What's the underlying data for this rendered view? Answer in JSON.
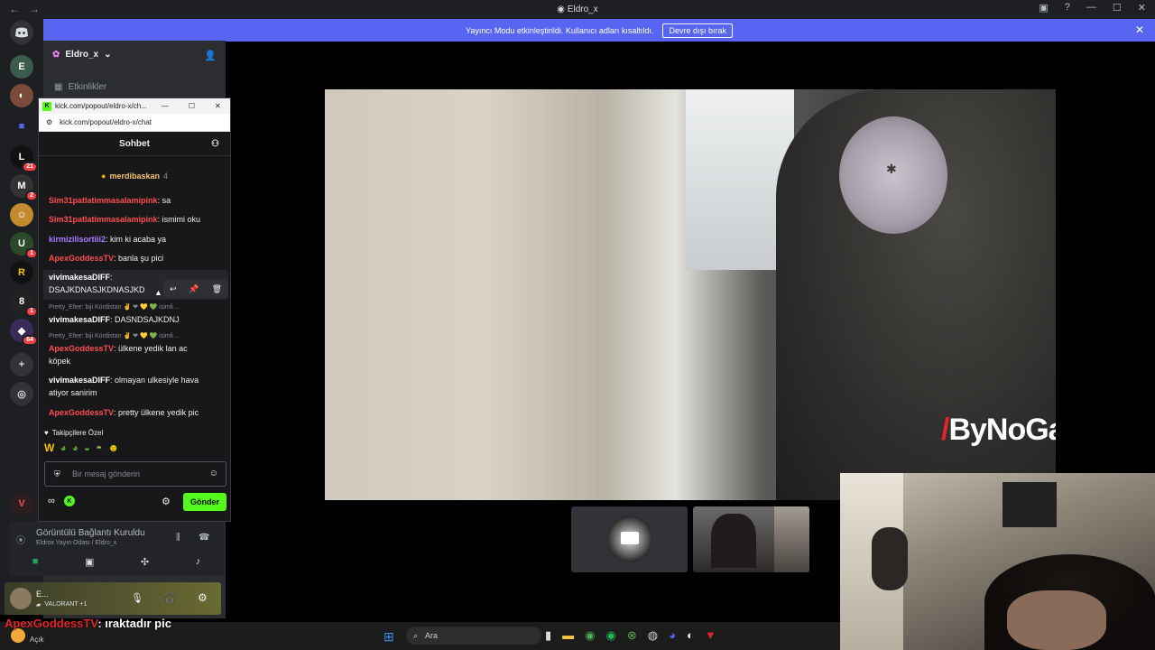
{
  "titlebar": {
    "title": "Eldro_x"
  },
  "banner": {
    "text": "Yayıncı Modu etkinleştirildi. Kullanıcı adları kısaltıldı.",
    "button": "Devre dışı bırak"
  },
  "server": {
    "name": "Eldro_x",
    "channel_events": "Etkinlikler"
  },
  "rail_badges": [
    "21",
    "2",
    "1",
    "1",
    "64"
  ],
  "popup": {
    "tab_title": "kick.com/popout/eldro-x/ch...",
    "url": "kick.com/popout/eldro-x/chat",
    "header": "Sohbet",
    "pinned_user": "merdibaskan",
    "pinned_count": "4",
    "messages": [
      {
        "user": "Sim31patlatimmasalamipink",
        "text": ": sa",
        "color": "red"
      },
      {
        "user": "Sim31patlatimmasalamipink",
        "text": ": ismimi oku",
        "color": "red"
      },
      {
        "user": "kirmizilisortiii2",
        "text": ": kim ki acaba ya",
        "color": "purple"
      },
      {
        "user": "ApexGoddessTV",
        "text": ": banla şu pici",
        "color": "red"
      },
      {
        "user": "vivimakesaDIFF",
        "text": ":",
        "text2": "DSAJKDNASJKDNASJKD",
        "color": "white"
      },
      {
        "reply": "Pretty_Efee: biji Kürdistan ✌ ❤ 💛 💚 isimli ...",
        "user": "vivimakesaDIFF",
        "text": ": DASNDSAJKDNJ",
        "color": "white"
      },
      {
        "reply": "Pretty_Efee: biji Kürdistan ✌ ❤ 💛 💚 isimli ...",
        "user": "ApexGoddessTV",
        "text": ": ülkene yedik lan ac",
        "text2": "köpek",
        "color": "red"
      },
      {
        "user": "vivimakesaDIFF",
        "text": ": olmayan ulkesiyle hava",
        "text2": "atiyor sanirim",
        "color": "white"
      },
      {
        "user": "ApexGoddessTV",
        "text": ": pretty ülkene yedik pic",
        "color": "red"
      }
    ],
    "followers_only": "Takipçilere Özel",
    "input_placeholder": "Bir mesaj gönderin",
    "send": "Gönder"
  },
  "voice": {
    "status": "Görüntülü Bağlantı Kuruldu",
    "room": "Eldrox Yayın Odası / Eldro_x"
  },
  "user": {
    "name": "E...",
    "game": "VALORANT +1"
  },
  "overlay": {
    "user": "ApexGoddessTV",
    "text": ": ıraktadır pic"
  },
  "taskbar": {
    "search": "Ara",
    "weather_sub": "Açık"
  },
  "watermark": "ByNoGame"
}
